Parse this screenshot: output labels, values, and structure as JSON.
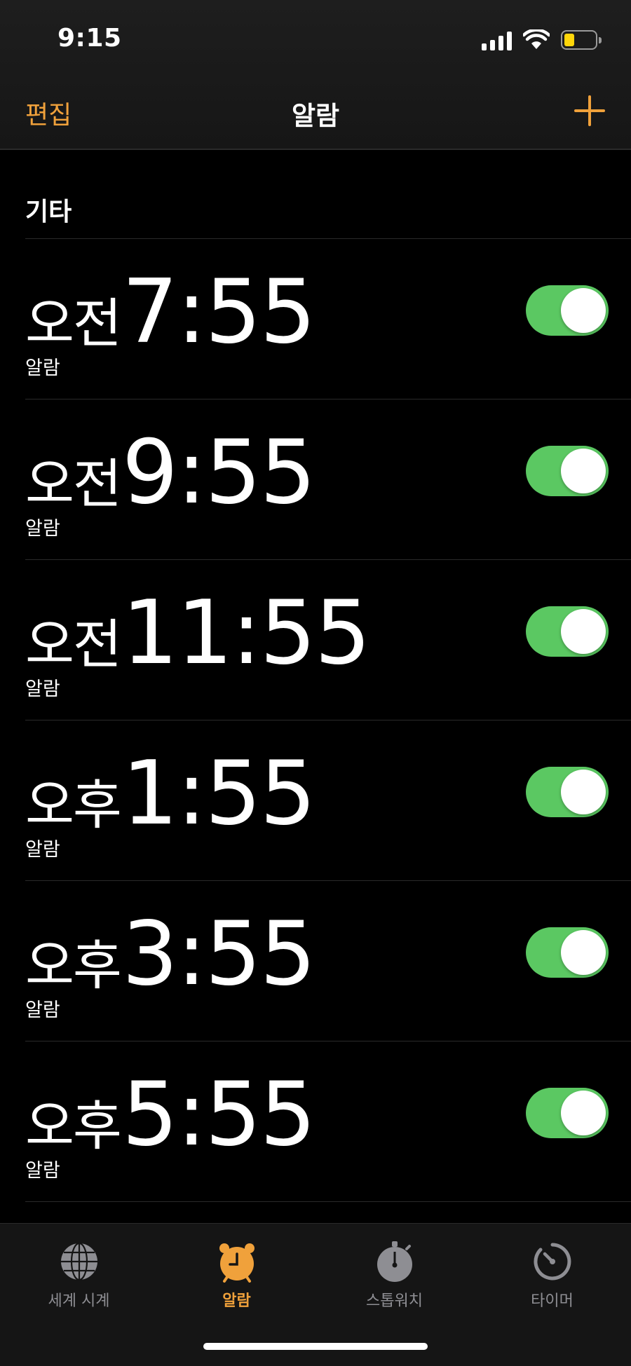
{
  "status_bar": {
    "time": "9:15"
  },
  "nav": {
    "edit_label": "편집",
    "title": "알람"
  },
  "section": {
    "title": "기타"
  },
  "alarms": [
    {
      "meridiem": "오전",
      "time": "7:55",
      "label": "알람",
      "enabled": true
    },
    {
      "meridiem": "오전",
      "time": "9:55",
      "label": "알람",
      "enabled": true
    },
    {
      "meridiem": "오전",
      "time": "11:55",
      "label": "알람",
      "enabled": true
    },
    {
      "meridiem": "오후",
      "time": "1:55",
      "label": "알람",
      "enabled": true
    },
    {
      "meridiem": "오후",
      "time": "3:55",
      "label": "알람",
      "enabled": true
    },
    {
      "meridiem": "오후",
      "time": "5:55",
      "label": "알람",
      "enabled": true
    }
  ],
  "tabs": [
    {
      "label": "세계 시계",
      "icon": "globe-icon",
      "active": false
    },
    {
      "label": "알람",
      "icon": "alarm-clock-icon",
      "active": true
    },
    {
      "label": "스톱워치",
      "icon": "stopwatch-icon",
      "active": false
    },
    {
      "label": "타이머",
      "icon": "timer-icon",
      "active": false
    }
  ],
  "colors": {
    "accent": "#f0a13b",
    "toggle_on": "#5bc862",
    "background": "#000000",
    "inactive_tab": "#8e8e93"
  }
}
